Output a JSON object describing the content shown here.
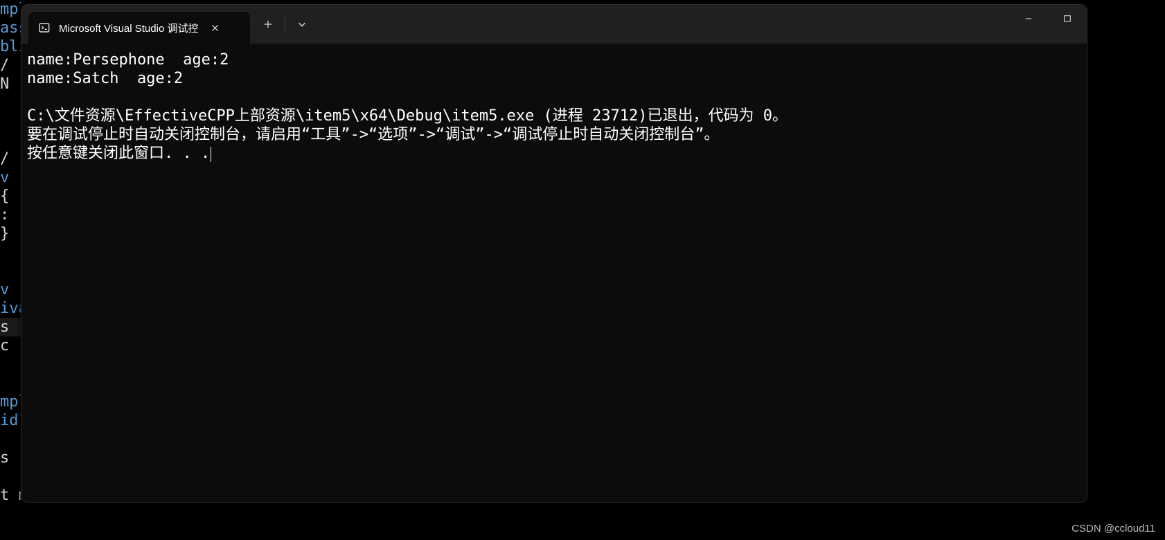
{
  "window": {
    "tab_title": "Microsoft Visual Studio 调试控",
    "icons": {
      "app": "terminal-icon",
      "close_tab": "close-icon",
      "new_tab": "plus-icon",
      "dropdown": "chevron-down-icon",
      "minimize": "minimize-icon",
      "maximize": "maximize-icon"
    }
  },
  "console": {
    "lines": [
      "name:Persephone  age:2",
      "name:Satch  age:2",
      "",
      "C:\\文件资源\\EffectiveCPP上部资源\\item5\\x64\\Debug\\item5.exe (进程 23712)已退出，代码为 0。",
      "要在调试停止时自动关闭控制台，请启用“工具”->“选项”->“调试”->“调试停止时自动关闭控制台”。",
      "按任意键关闭此窗口. . ."
    ]
  },
  "editor_bg": {
    "fragments": [
      "mpl",
      "ass",
      "bli",
      "/",
      "N",
      "",
      "",
      "",
      "/",
      "v",
      "{",
      ":",
      "}",
      "",
      "",
      "v",
      "iva",
      "s",
      "c",
      "",
      "",
      "mpl",
      "id",
      "",
      "s",
      "",
      "t m"
    ]
  },
  "watermark": "CSDN @ccloud11"
}
